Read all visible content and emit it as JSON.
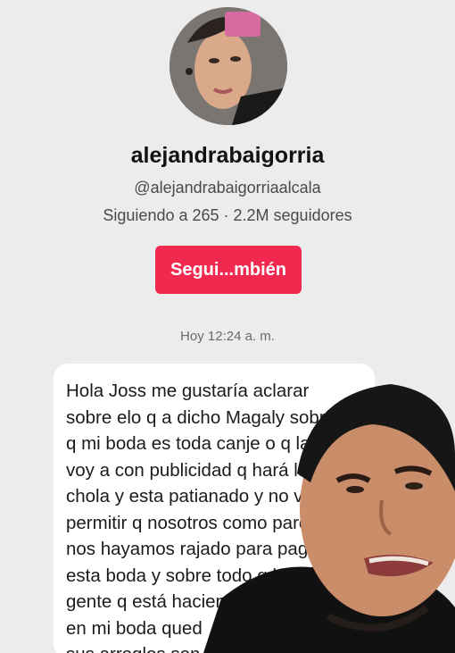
{
  "profile": {
    "username": "alejandrabaigorria",
    "handle": "@alejandrabaigorriaalcala",
    "stats": "Siguiendo a 265 · 2.2M seguidores",
    "follow_label": "Segui...mbién"
  },
  "chat": {
    "timestamp": "Hoy 12:24 a. m.",
    "lines": [
      "Hola Joss me gustaría aclarar",
      "sobre elo q a dicho Magaly sobre",
      "q mi boda es toda canje o q la",
      "voy a con publicidad q hará la",
      "chola y esta patianado y no voy a",
      "permitir q nosotros como pareja",
      "nos hayamos rajado para pagar",
      "esta boda y sobre todo q la",
      "gente q está haciendo",
      "en mi boda qued",
      "sus arreglos son"
    ]
  },
  "colors": {
    "background": "#ececec",
    "follow_button": "#f2294e",
    "bubble": "#ffffff"
  }
}
